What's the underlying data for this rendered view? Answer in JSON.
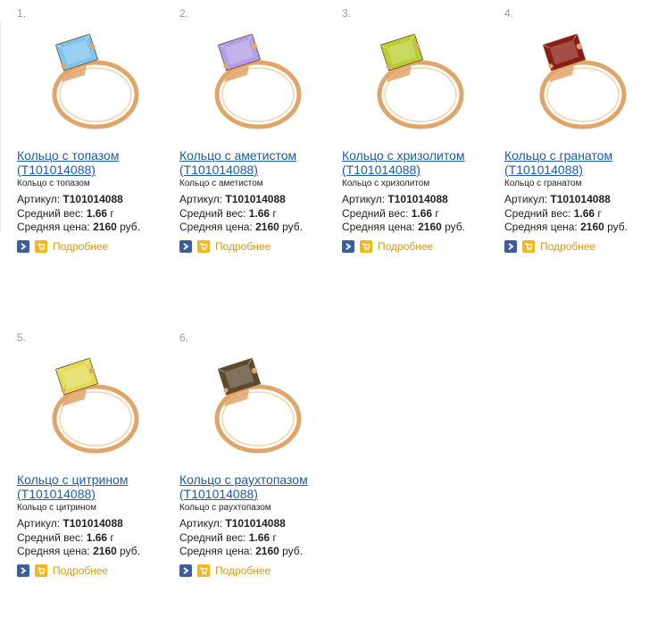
{
  "products": [
    {
      "number": "1.",
      "title": "Кольцо с топазом (Т101014088)",
      "subtitle": "Кольцо с топазом",
      "article_label": "Артикул: ",
      "article": "Т101014088",
      "weight_label": "Средний вес: ",
      "weight": "1.66",
      "weight_unit": " г",
      "price_label": "Средняя цена: ",
      "price": "2160",
      "price_unit": " руб.",
      "more_label": "Подробнее",
      "gem_color": "#7ec4ef"
    },
    {
      "number": "2.",
      "title": "Кольцо с аметистом (Т101014088)",
      "subtitle": "Кольцо с аметистом",
      "article_label": "Артикул: ",
      "article": "Т101014088",
      "weight_label": "Средний вес: ",
      "weight": "1.66",
      "weight_unit": " г",
      "price_label": "Средняя цена: ",
      "price": "2160",
      "price_unit": " руб.",
      "more_label": "Подробнее",
      "gem_color": "#b39ee6"
    },
    {
      "number": "3.",
      "title": "Кольцо с хризолитом (Т101014088)",
      "subtitle": "Кольцо с хризолитом",
      "article_label": "Артикул: ",
      "article": "Т101014088",
      "weight_label": "Средний вес: ",
      "weight": "1.66",
      "weight_unit": " г",
      "price_label": "Средняя цена: ",
      "price": "2160",
      "price_unit": " руб.",
      "more_label": "Подробнее",
      "gem_color": "#b8cf32"
    },
    {
      "number": "4.",
      "title": "Кольцо с гранатом (Т101014088)",
      "subtitle": "Кольцо с гранатом",
      "article_label": "Артикул: ",
      "article": "Т101014088",
      "weight_label": "Средний вес: ",
      "weight": "1.66",
      "weight_unit": " г",
      "price_label": "Средняя цена: ",
      "price": "2160",
      "price_unit": " руб.",
      "more_label": "Подробнее",
      "gem_color": "#8b1d14"
    },
    {
      "number": "5.",
      "title": "Кольцо с цитрином (Т101014088)",
      "subtitle": "Кольцо с цитрином",
      "article_label": "Артикул: ",
      "article": "Т101014088",
      "weight_label": "Средний вес: ",
      "weight": "1.66",
      "weight_unit": " г",
      "price_label": "Средняя цена: ",
      "price": "2160",
      "price_unit": " руб.",
      "more_label": "Подробнее",
      "gem_color": "#e0dc56"
    },
    {
      "number": "6.",
      "title": "Кольцо с раухтопазом (Т101014088)",
      "subtitle": "Кольцо с раухтопазом",
      "article_label": "Артикул: ",
      "article": "Т101014088",
      "weight_label": "Средний вес: ",
      "weight": "1.66",
      "weight_unit": " г",
      "price_label": "Средняя цена: ",
      "price": "2160",
      "price_unit": " руб.",
      "more_label": "Подробнее",
      "gem_color": "#5b4a2e"
    }
  ],
  "colors": {
    "link": "#1f5aa3",
    "more": "#d39b22",
    "arrow_button": "#3d5e9e",
    "cart_button": "#f2b71a",
    "gold": "#e0a56a"
  },
  "icons": {
    "arrow": "arrow-right-icon",
    "cart": "cart-icon"
  }
}
